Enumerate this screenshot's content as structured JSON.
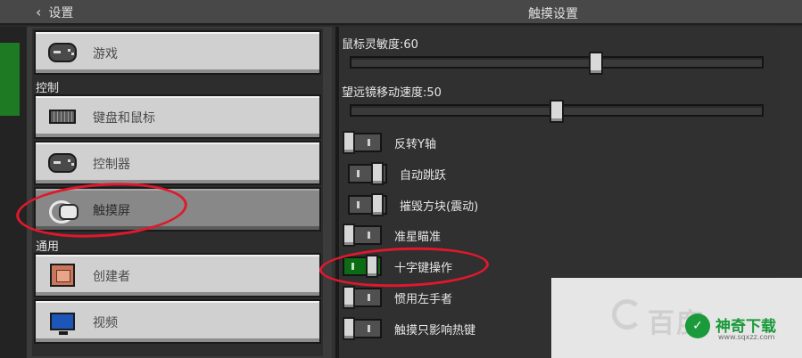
{
  "header": {
    "back_label": "设置",
    "title": "触摸设置"
  },
  "sidebar": {
    "sections": {
      "controls": "控制",
      "general": "通用"
    },
    "items": [
      {
        "label": "游戏",
        "icon": "gamepad-icon"
      },
      {
        "label": "键盘和鼠标",
        "icon": "keyboard-icon"
      },
      {
        "label": "控制器",
        "icon": "controller-icon"
      },
      {
        "label": "触摸屏",
        "icon": "touch-icon",
        "selected": true
      },
      {
        "label": "创建者",
        "icon": "creator-icon"
      },
      {
        "label": "视频",
        "icon": "monitor-icon"
      }
    ]
  },
  "settings": {
    "sliders": [
      {
        "label": "鼠标灵敏度:60",
        "value": 60,
        "min": 0,
        "max": 100
      },
      {
        "label": "望远镜移动速度:50",
        "value": 50,
        "min": 0,
        "max": 100
      }
    ],
    "toggles": [
      {
        "label": "反转Y轴",
        "on": false
      },
      {
        "label": "自动跳跃",
        "on": true
      },
      {
        "label": "摧毁方块(震动)",
        "on": true
      },
      {
        "label": "准星瞄准",
        "on": false
      },
      {
        "label": "十字键操作",
        "on": true
      },
      {
        "label": "惯用左手者",
        "on": false
      },
      {
        "label": "触摸只影响热键",
        "on": false
      }
    ]
  },
  "watermark": {
    "brand_a": "百度",
    "brand_b": "神奇下载",
    "url": "www.sqxzz.com"
  },
  "colors": {
    "toggle_on": "#0d6b15",
    "annotation": "#e0182d"
  }
}
